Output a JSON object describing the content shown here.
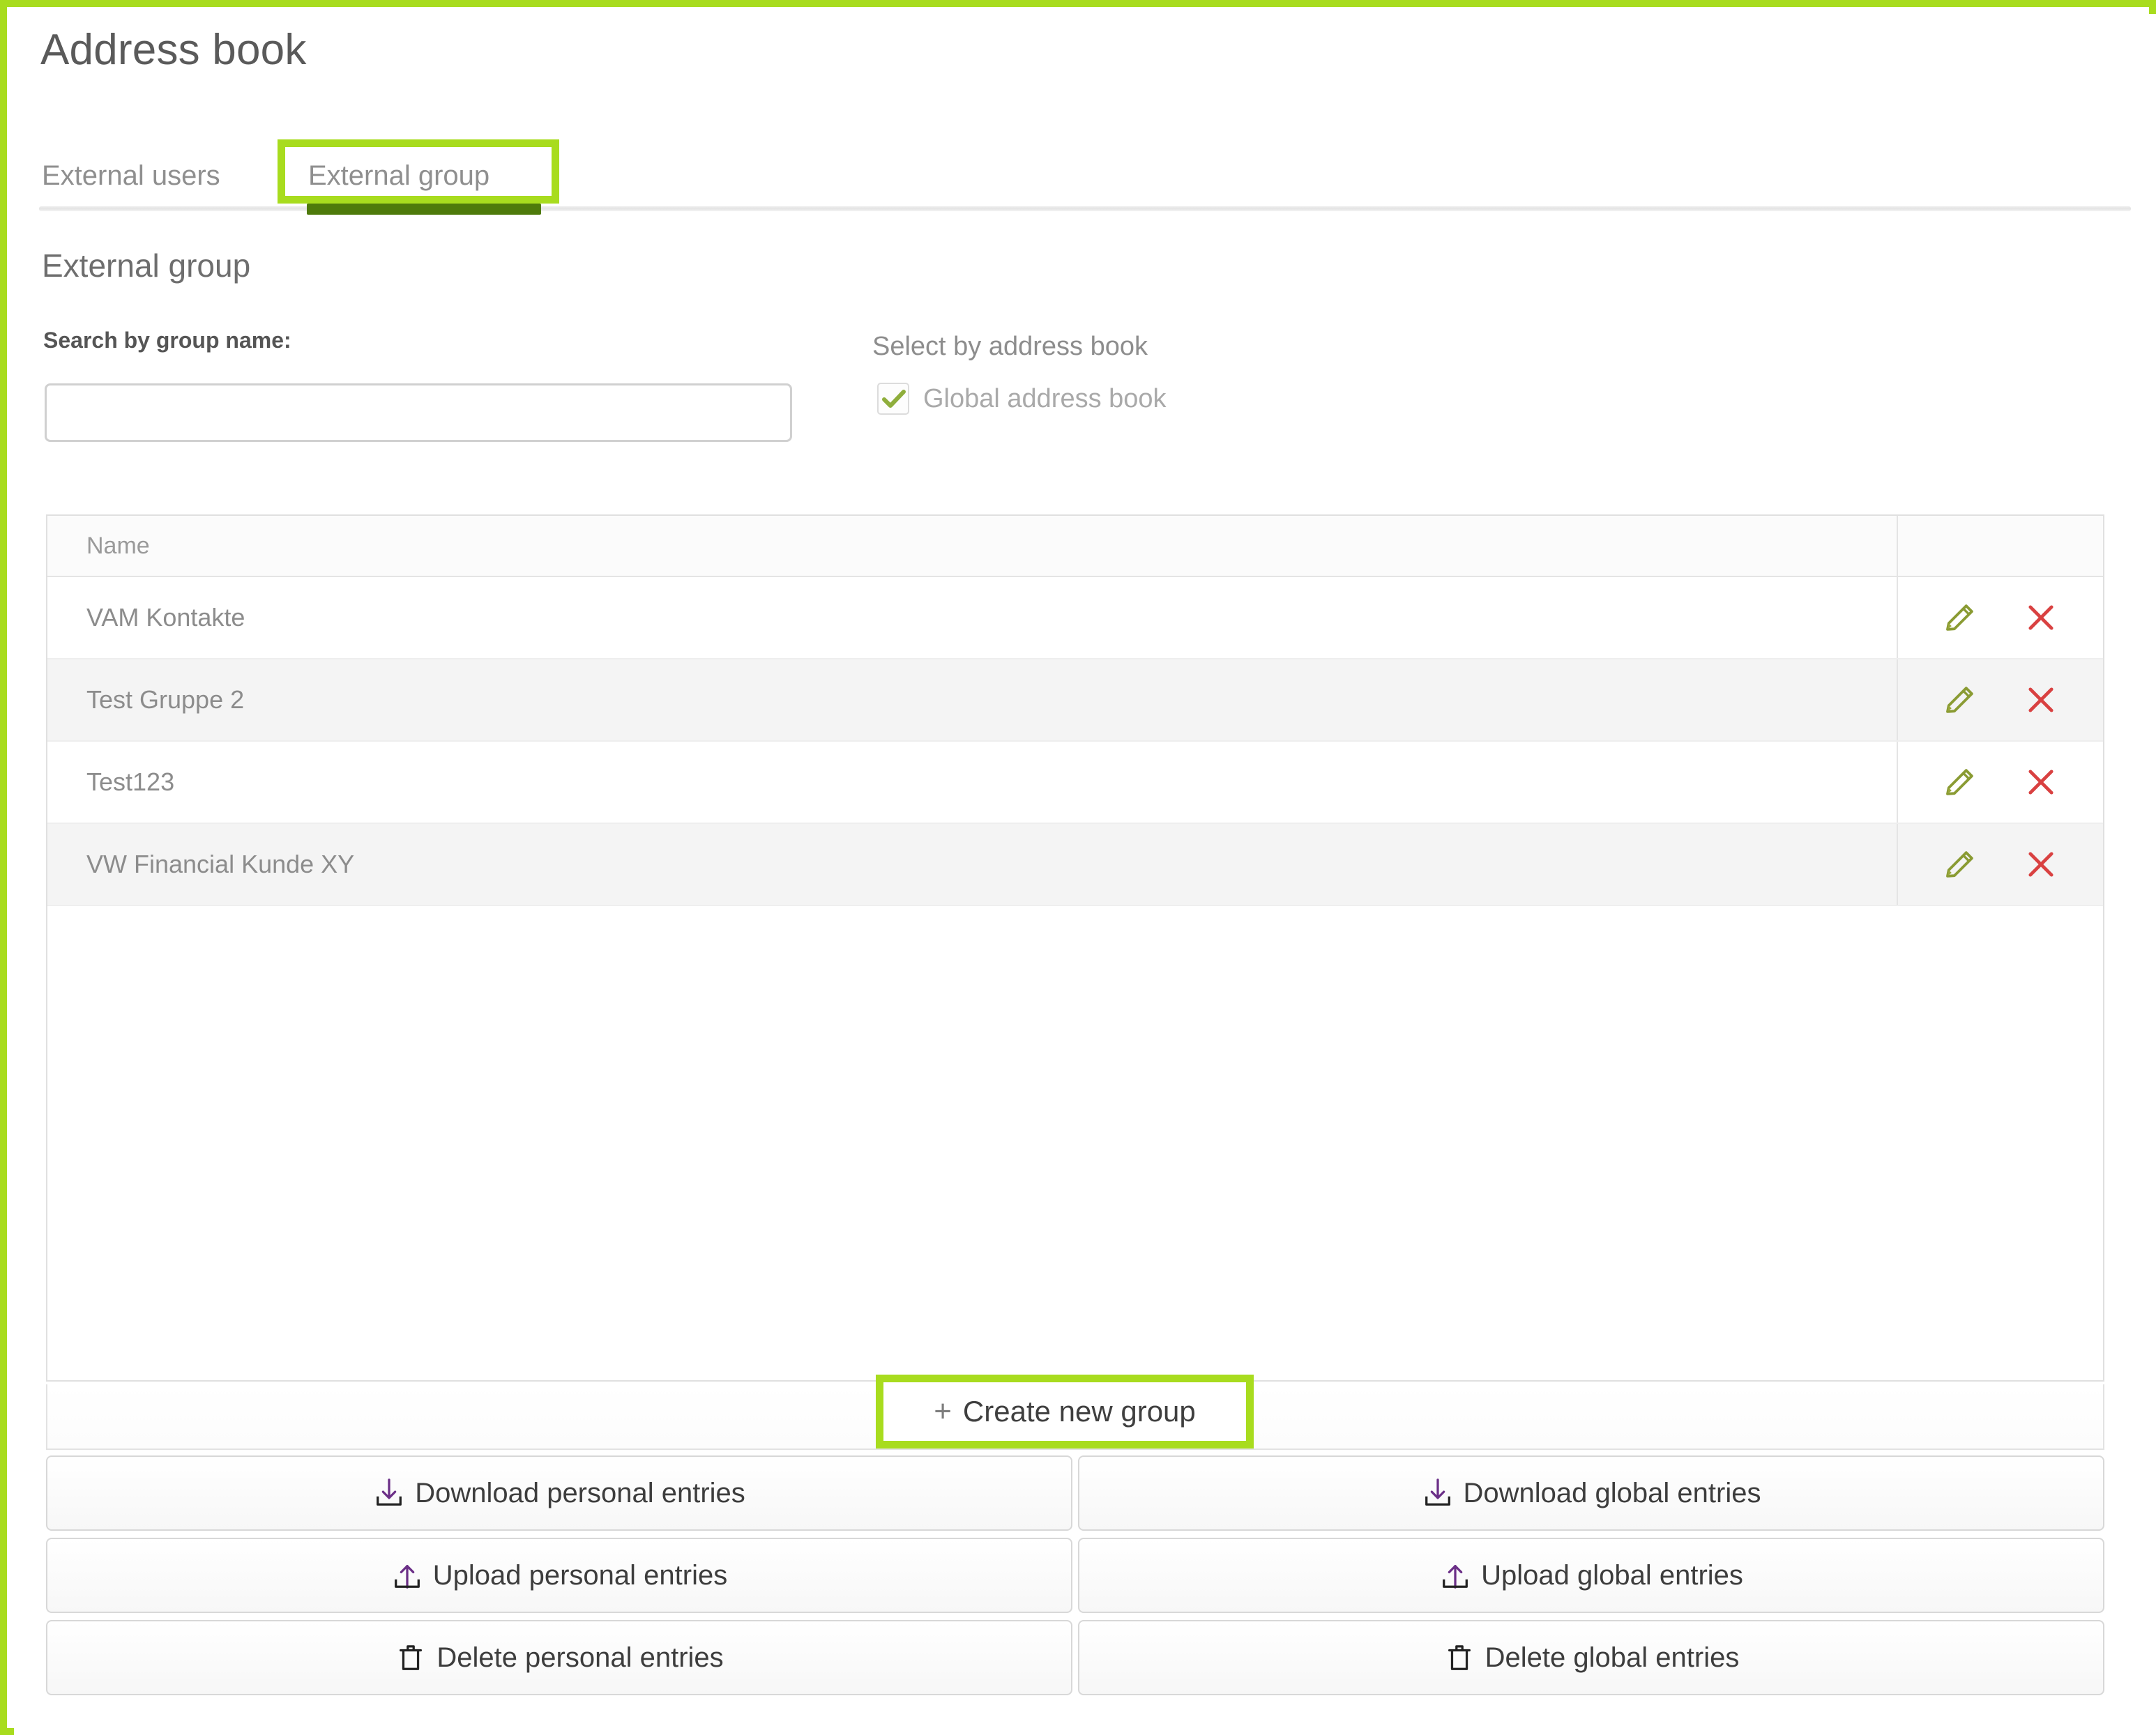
{
  "page": {
    "title": "Address book"
  },
  "tabs": [
    {
      "label": "External users",
      "active": false
    },
    {
      "label": "External group",
      "active": true,
      "highlighted": true
    }
  ],
  "section": {
    "heading": "External group"
  },
  "search": {
    "label": "Search by group name:",
    "value": "",
    "placeholder": ""
  },
  "address_book_filter": {
    "label": "Select by address book",
    "options": [
      {
        "label": "Global address book",
        "checked": true
      }
    ]
  },
  "table": {
    "columns": [
      "Name",
      ""
    ],
    "rows": [
      {
        "name": "VAM Kontakte",
        "edit_icon": "pencil-icon",
        "delete_icon": "close-x-icon"
      },
      {
        "name": "Test Gruppe 2",
        "edit_icon": "pencil-icon",
        "delete_icon": "close-x-icon"
      },
      {
        "name": "Test123",
        "edit_icon": "pencil-icon",
        "delete_icon": "close-x-icon"
      },
      {
        "name": "VW Financial Kunde XY",
        "edit_icon": "pencil-icon",
        "delete_icon": "close-x-icon"
      }
    ]
  },
  "create_button": {
    "plus": "+",
    "label": "Create new group",
    "icon": "plus-icon",
    "highlighted": true
  },
  "actions": [
    {
      "label": "Download personal entries",
      "icon": "download-icon"
    },
    {
      "label": "Download global entries",
      "icon": "download-icon"
    },
    {
      "label": "Upload personal entries",
      "icon": "upload-icon"
    },
    {
      "label": "Upload global entries",
      "icon": "upload-icon"
    },
    {
      "label": "Delete personal entries",
      "icon": "trash-icon"
    },
    {
      "label": "Delete global entries",
      "icon": "trash-icon"
    }
  ],
  "colors": {
    "highlight_green": "#a8dc1e",
    "active_tab_underline": "#4e7a0b",
    "checkbox_check": "#8fae3c",
    "delete_x_red": "#d94141",
    "pencil_olive": "#8a9b33"
  }
}
